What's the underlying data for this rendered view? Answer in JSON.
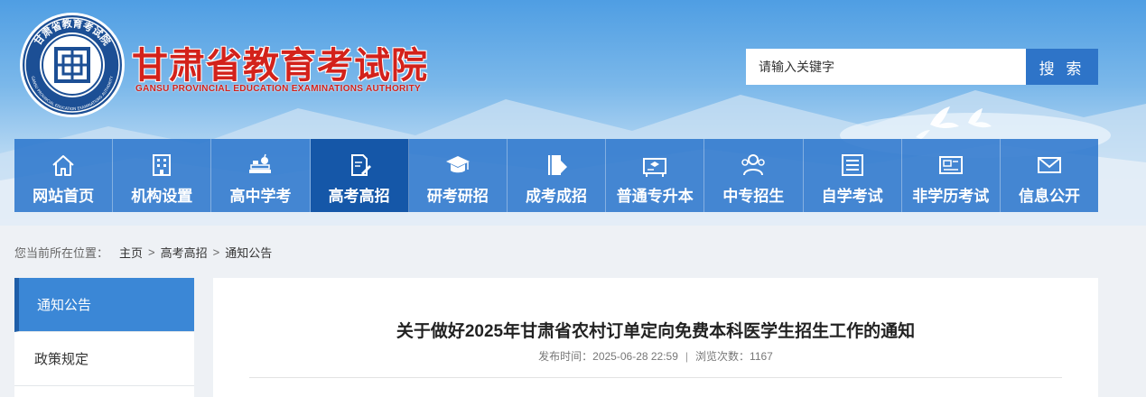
{
  "header": {
    "seal_text": "GANSU PROVINCIAL EDUCATION EXAMINATIONS AUTHORITY",
    "seal_char": "甘肃省教育考试院",
    "title": "甘肃省教育考试院",
    "subtitle": "GANSU PROVINCIAL EDUCATION EXAMINATIONS AUTHORITY",
    "brand_color": "#d3221b"
  },
  "search": {
    "placeholder": "请输入关键字",
    "button_label": "搜 索"
  },
  "nav": {
    "items": [
      {
        "label": "网站首页",
        "icon": "home-icon"
      },
      {
        "label": "机构设置",
        "icon": "building-icon"
      },
      {
        "label": "高中学考",
        "icon": "books-apple-icon"
      },
      {
        "label": "高考高招",
        "icon": "document-pen-icon"
      },
      {
        "label": "研考研招",
        "icon": "graduation-cap-icon"
      },
      {
        "label": "成考成招",
        "icon": "book-icon"
      },
      {
        "label": "普通专升本",
        "icon": "board-cap-icon"
      },
      {
        "label": "中专招生",
        "icon": "users-icon"
      },
      {
        "label": "自学考试",
        "icon": "list-icon"
      },
      {
        "label": "非学历考试",
        "icon": "id-card-icon"
      },
      {
        "label": "信息公开",
        "icon": "mail-icon"
      }
    ],
    "active_index": 3
  },
  "breadcrumb": {
    "prefix": "您当前所在位置：",
    "items": [
      "主页",
      "高考高招",
      "通知公告"
    ],
    "separator": ">"
  },
  "sidebar": {
    "items": [
      "通知公告",
      "政策规定"
    ],
    "active_index": 0
  },
  "article": {
    "title": "关于做好2025年甘肃省农村订单定向免费本科医学生招生工作的通知",
    "publish_label": "发布时间：",
    "publish_time": "2025-06-28 22:59",
    "meta_separator": "|",
    "views_label": "浏览次数：",
    "views": "1167"
  }
}
